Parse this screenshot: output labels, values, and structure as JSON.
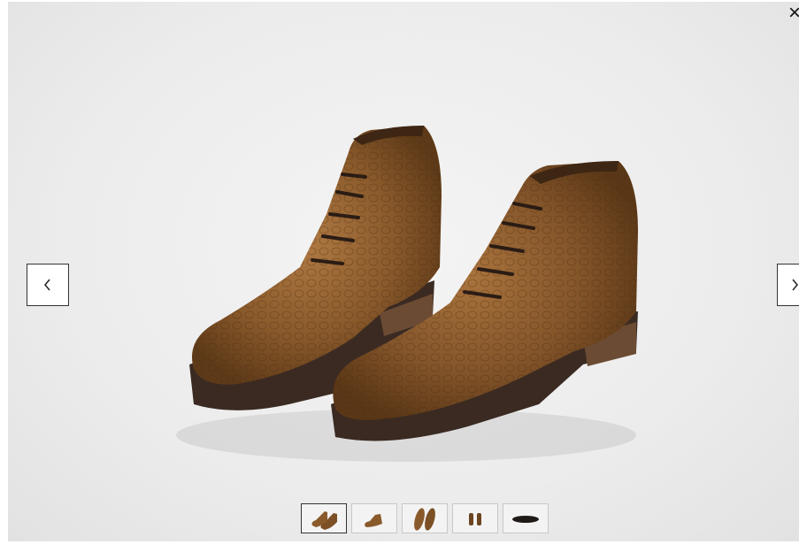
{
  "gallery": {
    "close_label": "×",
    "prev_icon": "chevron-left-icon",
    "next_icon": "chevron-right-icon",
    "main_image": "brown-pebble-grain-chukka-boots-pair",
    "colors": {
      "leather": "#8a5a2b",
      "leather_dark": "#5e3a18",
      "sole": "#3a2a22",
      "background": "#ececec"
    },
    "thumbnails": [
      {
        "name": "pair-angled",
        "active": true
      },
      {
        "name": "single-side",
        "active": false
      },
      {
        "name": "pair-top",
        "active": false
      },
      {
        "name": "pair-back",
        "active": false
      },
      {
        "name": "sole-bottom",
        "active": false
      }
    ]
  }
}
